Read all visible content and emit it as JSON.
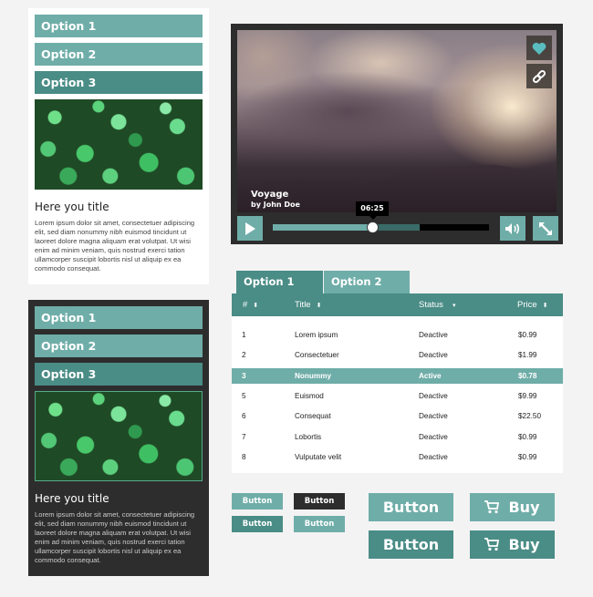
{
  "colors": {
    "accent_light": "#6fada8",
    "accent_dark": "#4a8c86",
    "dark_bg": "#2d2d2d",
    "page_bg": "#f3f3f3"
  },
  "light_card": {
    "options": [
      {
        "label": "Option 1",
        "active": false
      },
      {
        "label": "Option 2",
        "active": false
      },
      {
        "label": "Option 3",
        "active": true
      }
    ],
    "image": "green-leaves-photo",
    "title": "Here you title",
    "body": "Lorem ipsum dolor sit amet, consectetuer adipiscing elit, sed diam nonummy nibh euismod tincidunt ut laoreet dolore magna aliquam erat volutpat. Ut wisi enim ad minim veniam, quis nostrud exerci tation ullamcorper suscipit lobortis nisl ut aliquip ex ea commodo consequat."
  },
  "dark_card": {
    "options": [
      {
        "label": "Option 1",
        "active": false
      },
      {
        "label": "Option 2",
        "active": false
      },
      {
        "label": "Option 3",
        "active": true
      }
    ],
    "image": "green-leaves-photo",
    "title": "Here you title",
    "body": "Lorem ipsum dolor sit amet, consectetuer adipiscing elit, sed diam nonummy nibh euismod tincidunt ut laoreet dolore magna aliquam erat volutpat. Ut wisi enim ad minim veniam, quis nostrud exerci tation ullamcorper suscipit lobortis nisl ut aliquip ex ea commodo consequat."
  },
  "video": {
    "title": "Voyage",
    "author": "by John Doe",
    "time": "06:25",
    "played_fraction": 0.46,
    "buffered_fraction": 0.68,
    "icons": {
      "favorite": "heart-icon",
      "share": "link-icon",
      "play": "play-icon",
      "volume": "volume-icon",
      "fullscreen": "fullscreen-icon"
    }
  },
  "table": {
    "tabs": [
      {
        "label": "Option 1",
        "active": true
      },
      {
        "label": "Option 2",
        "active": false
      }
    ],
    "columns": [
      {
        "label": "#",
        "sort": "sort-icon"
      },
      {
        "label": "Title",
        "sort": "sort-icon"
      },
      {
        "label": "Status",
        "sort": "dropdown-icon"
      },
      {
        "label": "Price",
        "sort": "sort-icon"
      }
    ],
    "rows": [
      {
        "num": "1",
        "title": "Lorem ipsum",
        "status": "Deactive",
        "price": "$0.99",
        "active": false
      },
      {
        "num": "2",
        "title": "Consectetuer",
        "status": "Deactive",
        "price": "$1.99",
        "active": false
      },
      {
        "num": "3",
        "title": "Nonummy",
        "status": "Active",
        "price": "$0.78",
        "active": true
      },
      {
        "num": "5",
        "title": "Euismod",
        "status": "Deactive",
        "price": "$9.99",
        "active": false
      },
      {
        "num": "6",
        "title": "Consequat",
        "status": "Deactive",
        "price": "$22.50",
        "active": false
      },
      {
        "num": "7",
        "title": "Lobortis",
        "status": "Deactive",
        "price": "$0.99",
        "active": false
      },
      {
        "num": "8",
        "title": "Vulputate velit",
        "status": "Deactive",
        "price": "$0.99",
        "active": false
      }
    ]
  },
  "buttons": {
    "small": [
      "Button",
      "Button",
      "Button",
      "Button"
    ],
    "large": [
      "Button",
      "Button"
    ],
    "buy": [
      "Buy",
      "Buy"
    ],
    "buy_icon": "cart-icon"
  }
}
